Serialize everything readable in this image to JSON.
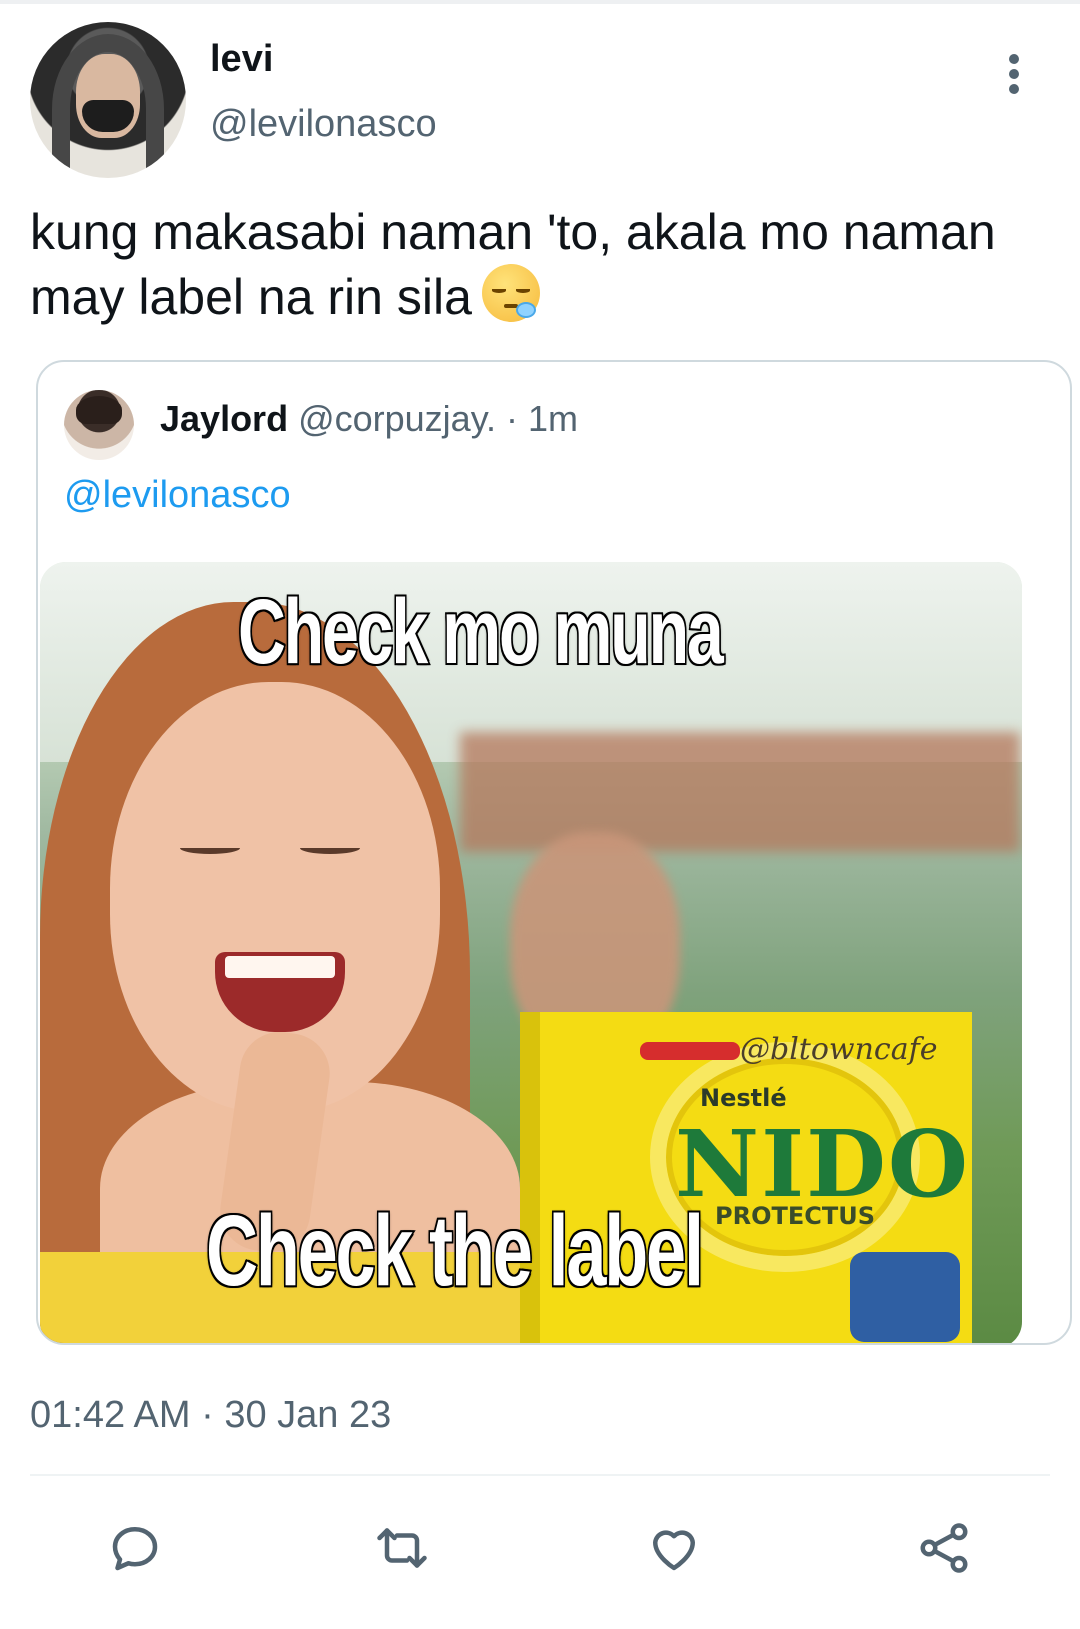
{
  "tweet": {
    "author": {
      "display_name": "levi",
      "handle": "@levilonasco"
    },
    "text_lines": [
      "kung makasabi naman 'to, akala mo naman",
      "may label na rin sila"
    ],
    "emoji": "sleepy-face",
    "timestamp": "01:42 AM · 30 Jan 23"
  },
  "quoted_tweet": {
    "display_name": "Jaylord",
    "meta": "@corpuzjay. · 1m",
    "mention": "@levilonasco",
    "media": {
      "caption_top": "Check mo muna",
      "caption_bottom": "Check the label",
      "watermark": "@bltowncafe",
      "brand_small": "Nestlé",
      "brand": "NIDO",
      "subbrand": "PROTECTUS"
    }
  },
  "actions": [
    "reply-icon",
    "retweet-icon",
    "like-icon",
    "share-icon"
  ],
  "colors": {
    "text": "#0f1419",
    "secondary": "#536471",
    "link": "#1d9bf0",
    "border": "#cfd9de"
  }
}
